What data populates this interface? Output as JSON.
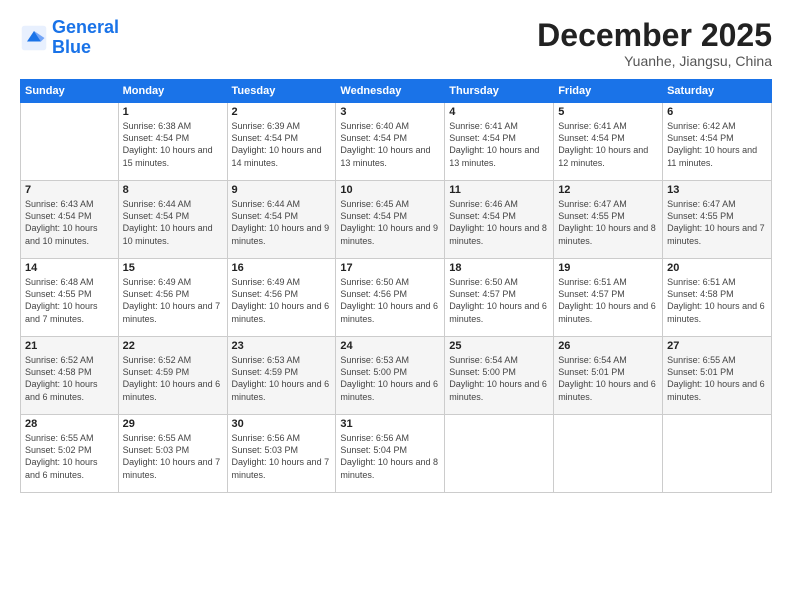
{
  "logo": {
    "line1": "General",
    "line2": "Blue"
  },
  "title": "December 2025",
  "subtitle": "Yuanhe, Jiangsu, China",
  "weekdays": [
    "Sunday",
    "Monday",
    "Tuesday",
    "Wednesday",
    "Thursday",
    "Friday",
    "Saturday"
  ],
  "weeks": [
    [
      {
        "day": "",
        "sunrise": "",
        "sunset": "",
        "daylight": ""
      },
      {
        "day": "1",
        "sunrise": "Sunrise: 6:38 AM",
        "sunset": "Sunset: 4:54 PM",
        "daylight": "Daylight: 10 hours and 15 minutes."
      },
      {
        "day": "2",
        "sunrise": "Sunrise: 6:39 AM",
        "sunset": "Sunset: 4:54 PM",
        "daylight": "Daylight: 10 hours and 14 minutes."
      },
      {
        "day": "3",
        "sunrise": "Sunrise: 6:40 AM",
        "sunset": "Sunset: 4:54 PM",
        "daylight": "Daylight: 10 hours and 13 minutes."
      },
      {
        "day": "4",
        "sunrise": "Sunrise: 6:41 AM",
        "sunset": "Sunset: 4:54 PM",
        "daylight": "Daylight: 10 hours and 13 minutes."
      },
      {
        "day": "5",
        "sunrise": "Sunrise: 6:41 AM",
        "sunset": "Sunset: 4:54 PM",
        "daylight": "Daylight: 10 hours and 12 minutes."
      },
      {
        "day": "6",
        "sunrise": "Sunrise: 6:42 AM",
        "sunset": "Sunset: 4:54 PM",
        "daylight": "Daylight: 10 hours and 11 minutes."
      }
    ],
    [
      {
        "day": "7",
        "sunrise": "Sunrise: 6:43 AM",
        "sunset": "Sunset: 4:54 PM",
        "daylight": "Daylight: 10 hours and 10 minutes."
      },
      {
        "day": "8",
        "sunrise": "Sunrise: 6:44 AM",
        "sunset": "Sunset: 4:54 PM",
        "daylight": "Daylight: 10 hours and 10 minutes."
      },
      {
        "day": "9",
        "sunrise": "Sunrise: 6:44 AM",
        "sunset": "Sunset: 4:54 PM",
        "daylight": "Daylight: 10 hours and 9 minutes."
      },
      {
        "day": "10",
        "sunrise": "Sunrise: 6:45 AM",
        "sunset": "Sunset: 4:54 PM",
        "daylight": "Daylight: 10 hours and 9 minutes."
      },
      {
        "day": "11",
        "sunrise": "Sunrise: 6:46 AM",
        "sunset": "Sunset: 4:54 PM",
        "daylight": "Daylight: 10 hours and 8 minutes."
      },
      {
        "day": "12",
        "sunrise": "Sunrise: 6:47 AM",
        "sunset": "Sunset: 4:55 PM",
        "daylight": "Daylight: 10 hours and 8 minutes."
      },
      {
        "day": "13",
        "sunrise": "Sunrise: 6:47 AM",
        "sunset": "Sunset: 4:55 PM",
        "daylight": "Daylight: 10 hours and 7 minutes."
      }
    ],
    [
      {
        "day": "14",
        "sunrise": "Sunrise: 6:48 AM",
        "sunset": "Sunset: 4:55 PM",
        "daylight": "Daylight: 10 hours and 7 minutes."
      },
      {
        "day": "15",
        "sunrise": "Sunrise: 6:49 AM",
        "sunset": "Sunset: 4:56 PM",
        "daylight": "Daylight: 10 hours and 7 minutes."
      },
      {
        "day": "16",
        "sunrise": "Sunrise: 6:49 AM",
        "sunset": "Sunset: 4:56 PM",
        "daylight": "Daylight: 10 hours and 6 minutes."
      },
      {
        "day": "17",
        "sunrise": "Sunrise: 6:50 AM",
        "sunset": "Sunset: 4:56 PM",
        "daylight": "Daylight: 10 hours and 6 minutes."
      },
      {
        "day": "18",
        "sunrise": "Sunrise: 6:50 AM",
        "sunset": "Sunset: 4:57 PM",
        "daylight": "Daylight: 10 hours and 6 minutes."
      },
      {
        "day": "19",
        "sunrise": "Sunrise: 6:51 AM",
        "sunset": "Sunset: 4:57 PM",
        "daylight": "Daylight: 10 hours and 6 minutes."
      },
      {
        "day": "20",
        "sunrise": "Sunrise: 6:51 AM",
        "sunset": "Sunset: 4:58 PM",
        "daylight": "Daylight: 10 hours and 6 minutes."
      }
    ],
    [
      {
        "day": "21",
        "sunrise": "Sunrise: 6:52 AM",
        "sunset": "Sunset: 4:58 PM",
        "daylight": "Daylight: 10 hours and 6 minutes."
      },
      {
        "day": "22",
        "sunrise": "Sunrise: 6:52 AM",
        "sunset": "Sunset: 4:59 PM",
        "daylight": "Daylight: 10 hours and 6 minutes."
      },
      {
        "day": "23",
        "sunrise": "Sunrise: 6:53 AM",
        "sunset": "Sunset: 4:59 PM",
        "daylight": "Daylight: 10 hours and 6 minutes."
      },
      {
        "day": "24",
        "sunrise": "Sunrise: 6:53 AM",
        "sunset": "Sunset: 5:00 PM",
        "daylight": "Daylight: 10 hours and 6 minutes."
      },
      {
        "day": "25",
        "sunrise": "Sunrise: 6:54 AM",
        "sunset": "Sunset: 5:00 PM",
        "daylight": "Daylight: 10 hours and 6 minutes."
      },
      {
        "day": "26",
        "sunrise": "Sunrise: 6:54 AM",
        "sunset": "Sunset: 5:01 PM",
        "daylight": "Daylight: 10 hours and 6 minutes."
      },
      {
        "day": "27",
        "sunrise": "Sunrise: 6:55 AM",
        "sunset": "Sunset: 5:01 PM",
        "daylight": "Daylight: 10 hours and 6 minutes."
      }
    ],
    [
      {
        "day": "28",
        "sunrise": "Sunrise: 6:55 AM",
        "sunset": "Sunset: 5:02 PM",
        "daylight": "Daylight: 10 hours and 6 minutes."
      },
      {
        "day": "29",
        "sunrise": "Sunrise: 6:55 AM",
        "sunset": "Sunset: 5:03 PM",
        "daylight": "Daylight: 10 hours and 7 minutes."
      },
      {
        "day": "30",
        "sunrise": "Sunrise: 6:56 AM",
        "sunset": "Sunset: 5:03 PM",
        "daylight": "Daylight: 10 hours and 7 minutes."
      },
      {
        "day": "31",
        "sunrise": "Sunrise: 6:56 AM",
        "sunset": "Sunset: 5:04 PM",
        "daylight": "Daylight: 10 hours and 8 minutes."
      },
      {
        "day": "",
        "sunrise": "",
        "sunset": "",
        "daylight": ""
      },
      {
        "day": "",
        "sunrise": "",
        "sunset": "",
        "daylight": ""
      },
      {
        "day": "",
        "sunrise": "",
        "sunset": "",
        "daylight": ""
      }
    ]
  ]
}
